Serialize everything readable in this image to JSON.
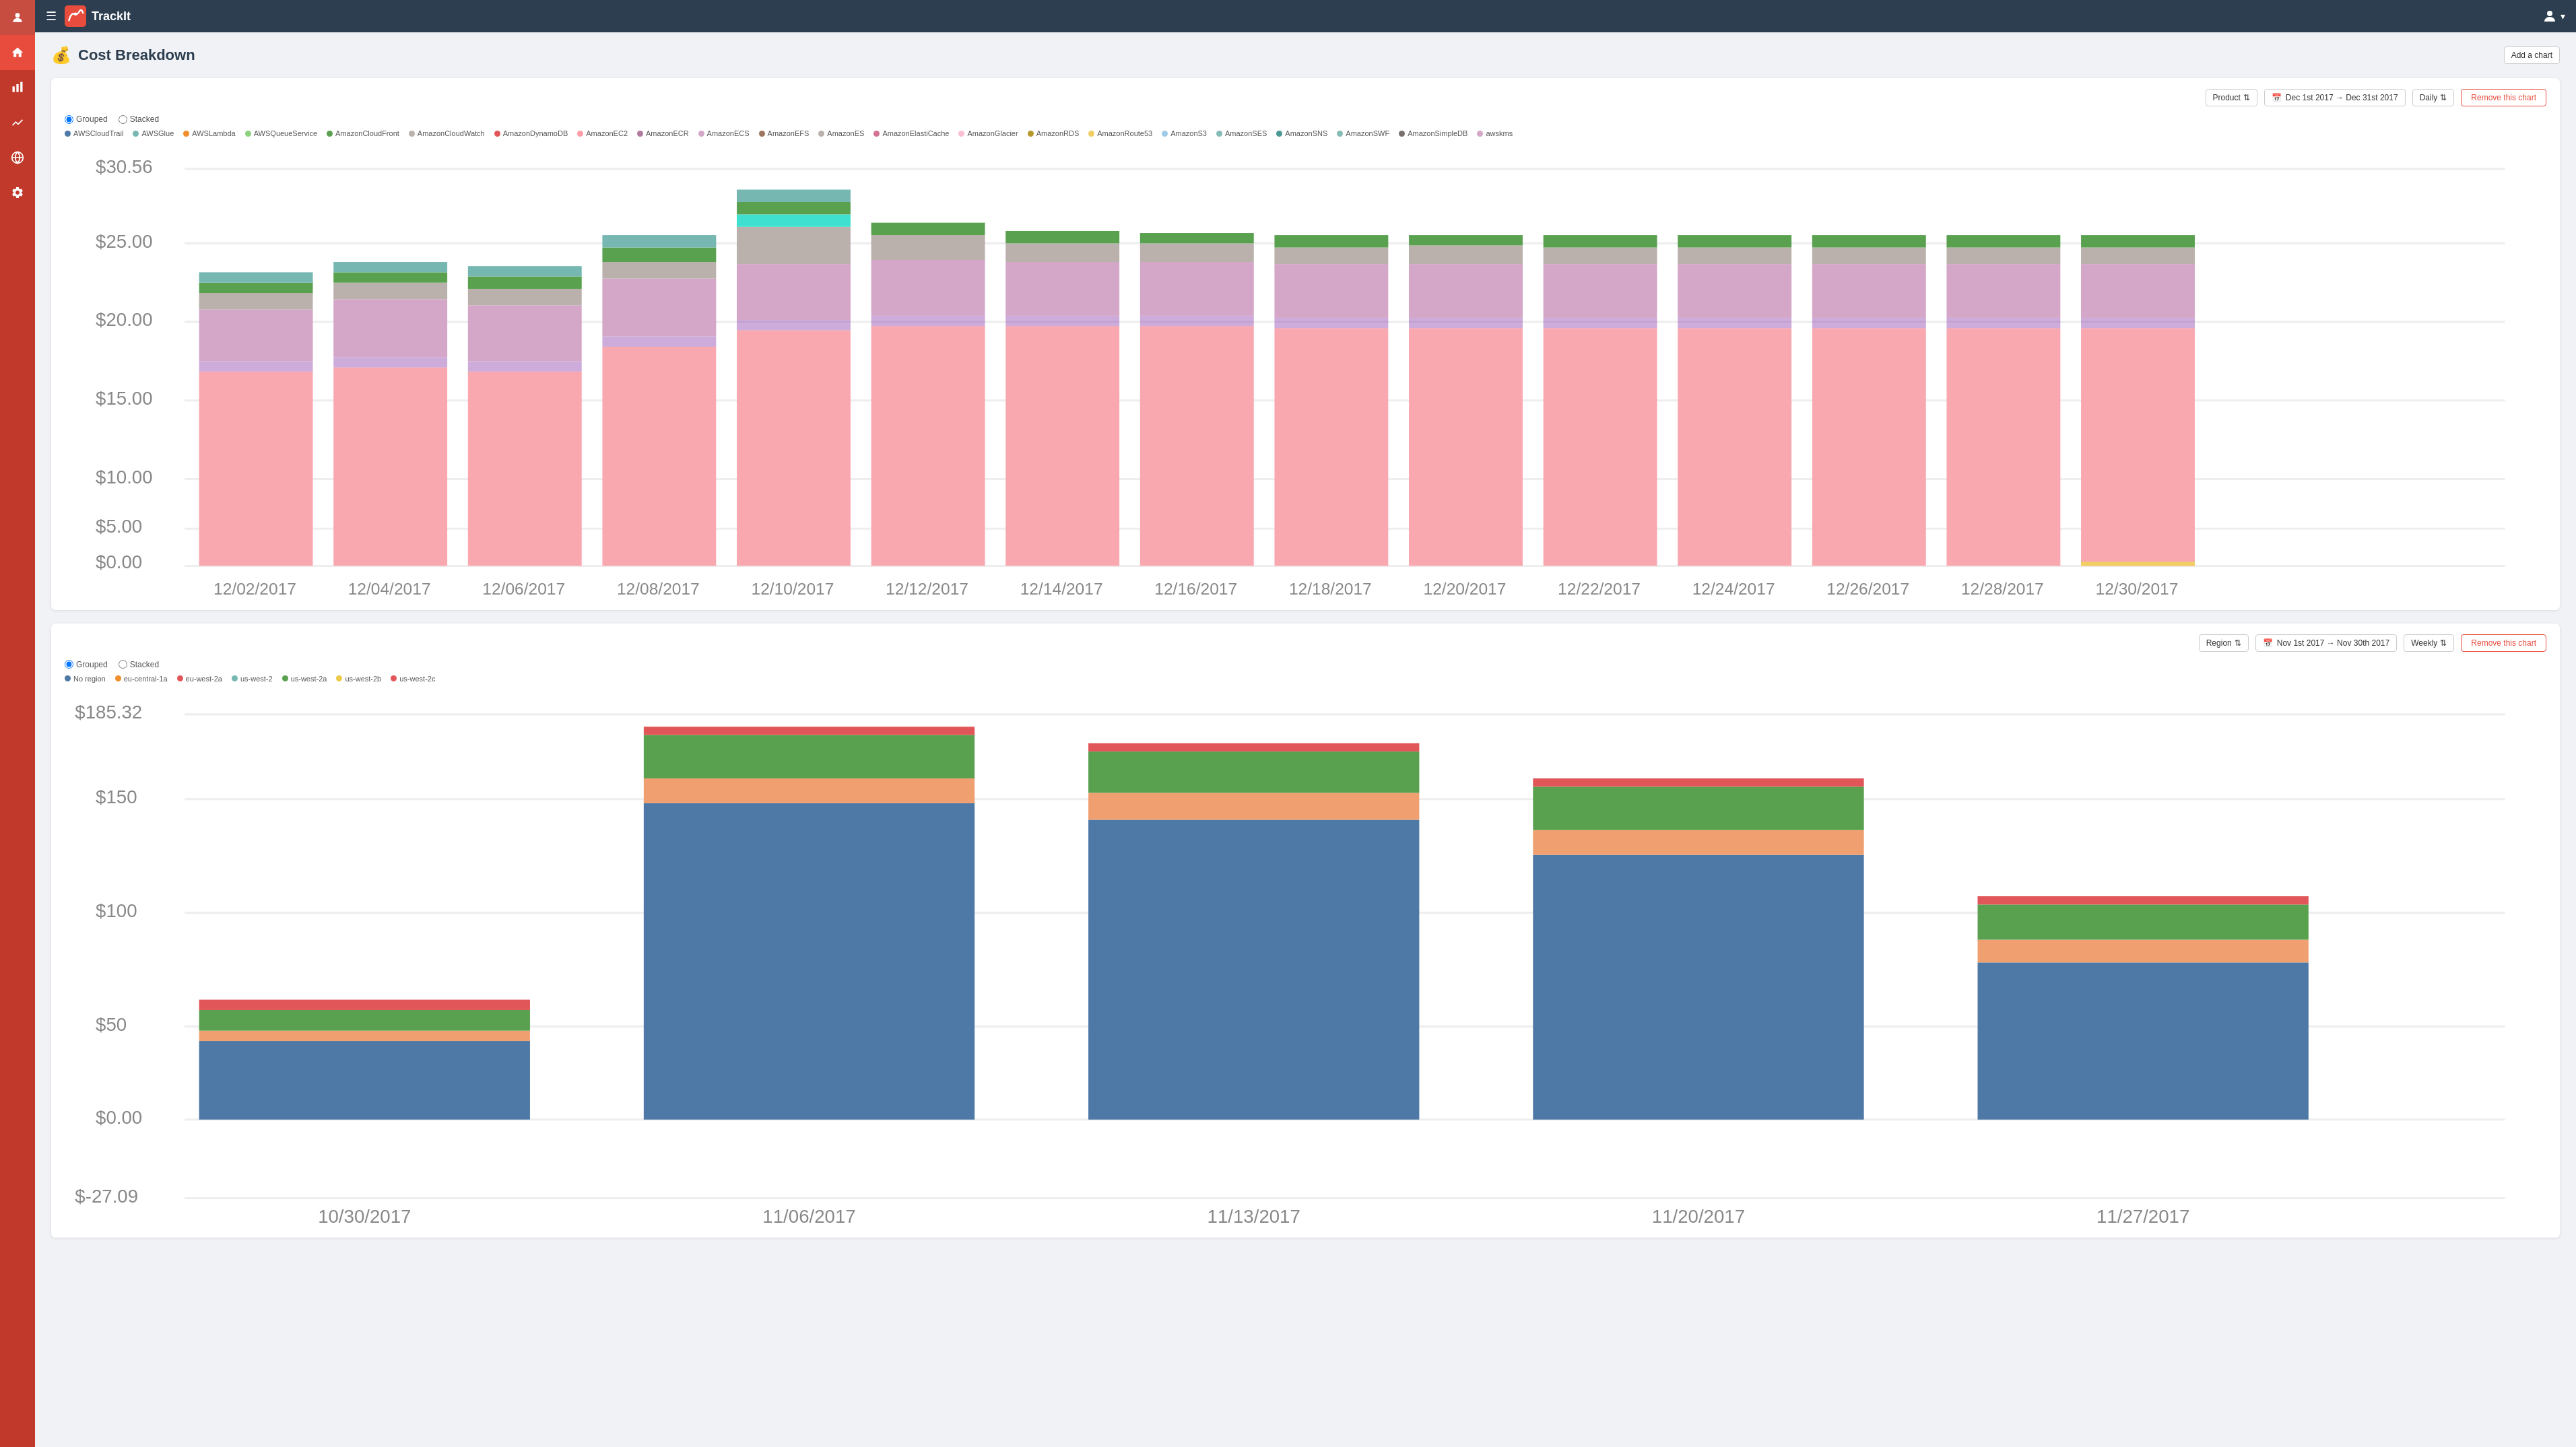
{
  "app": {
    "name": "TrackIt",
    "hamburger_icon": "☰",
    "user_icon": "👤"
  },
  "sidebar": {
    "items": [
      {
        "name": "user",
        "icon": "👤",
        "active": false
      },
      {
        "name": "home",
        "icon": "🏠",
        "active": true
      },
      {
        "name": "bar-chart",
        "icon": "📊",
        "active": false
      },
      {
        "name": "line-chart",
        "icon": "📈",
        "active": false
      },
      {
        "name": "globe",
        "icon": "🌐",
        "active": false
      },
      {
        "name": "settings",
        "icon": "⚙️",
        "active": false
      }
    ]
  },
  "page": {
    "title": "Cost Breakdown",
    "add_chart_label": "Add a chart"
  },
  "chart1": {
    "group_label": "Grouped",
    "stack_label": "Stacked",
    "filter_label": "Product",
    "date_range": "Dec 1st 2017 → Dec 31st 2017",
    "interval_label": "Daily",
    "remove_label": "Remove this chart",
    "legend": [
      {
        "name": "AWSCloudTrail",
        "color": "#4e79a7"
      },
      {
        "name": "AWSGlue",
        "color": "#76b7b2"
      },
      {
        "name": "AWSLambda",
        "color": "#f28e2b"
      },
      {
        "name": "AWSQueueService",
        "color": "#8cd17d"
      },
      {
        "name": "AmazonCloudFront",
        "color": "#59a14f"
      },
      {
        "name": "AmazonCloudWatch",
        "color": "#bab0ac"
      },
      {
        "name": "AmazonDynamoDB",
        "color": "#e15759"
      },
      {
        "name": "AmazonEC2",
        "color": "#ff9da7"
      },
      {
        "name": "AmazonECR",
        "color": "#b07aa1"
      },
      {
        "name": "AmazonECS",
        "color": "#d4a6c8"
      },
      {
        "name": "AmazonEFS",
        "color": "#9c755f"
      },
      {
        "name": "AmazonES",
        "color": "#bab0ac"
      },
      {
        "name": "AmazonElastiCache",
        "color": "#d37295"
      },
      {
        "name": "AmazonGlacier",
        "color": "#fabfd2"
      },
      {
        "name": "AmazonRDS",
        "color": "#b6992d"
      },
      {
        "name": "AmazonRoute53",
        "color": "#f1ce63"
      },
      {
        "name": "AmazonS3",
        "color": "#a0cbe8"
      },
      {
        "name": "AmazonSES",
        "color": "#86bcb6"
      },
      {
        "name": "AmazonSNS",
        "color": "#499894"
      },
      {
        "name": "AmazonSWF",
        "color": "#86bcb6"
      },
      {
        "name": "AmazonSimpleDB",
        "color": "#79706e"
      },
      {
        "name": "awskms",
        "color": "#d4a6c8"
      }
    ],
    "y_labels": [
      "$30.56",
      "$25.00",
      "$20.00",
      "$15.00",
      "$10.00",
      "$5.00",
      "$0.00"
    ],
    "x_labels": [
      "12/02/2017",
      "12/04/2017",
      "12/06/2017",
      "12/08/2017",
      "12/10/2017",
      "12/12/2017",
      "12/14/2017",
      "12/16/2017",
      "12/18/2017",
      "12/20/2017",
      "12/22/2017",
      "12/24/2017",
      "12/26/2017",
      "12/28/2017",
      "12/30/2017"
    ]
  },
  "chart2": {
    "group_label": "Grouped",
    "stack_label": "Stacked",
    "filter_label": "Region",
    "date_range": "Nov 1st 2017 → Nov 30th 2017",
    "interval_label": "Weekly",
    "remove_label": "Remove this chart",
    "legend": [
      {
        "name": "No region",
        "color": "#4e79a7"
      },
      {
        "name": "eu-central-1a",
        "color": "#f28e2b"
      },
      {
        "name": "eu-west-2a",
        "color": "#e15759"
      },
      {
        "name": "us-west-2",
        "color": "#76b7b2"
      },
      {
        "name": "us-west-2a",
        "color": "#59a14f"
      },
      {
        "name": "us-west-2b",
        "color": "#edc948"
      },
      {
        "name": "us-west-2c",
        "color": "#e15759"
      }
    ],
    "y_labels": [
      "$185.32",
      "$150",
      "$100",
      "$50",
      "$0.00",
      "$-27.09"
    ],
    "x_labels": [
      "10/30/2017",
      "11/06/2017",
      "11/13/2017",
      "11/20/2017",
      "11/27/2017"
    ]
  }
}
